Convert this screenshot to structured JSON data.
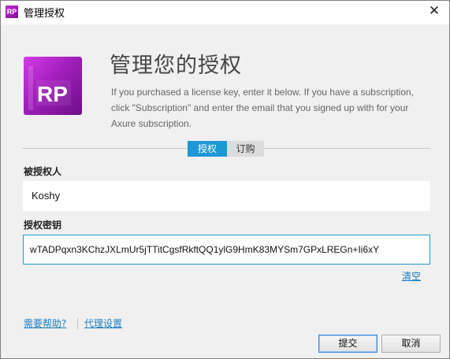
{
  "window": {
    "title": "管理授权",
    "app_icon_text": "RP",
    "close_glyph": "✕"
  },
  "header": {
    "logo_text": "RP",
    "heading": "管理您的授权",
    "description": "If you purchased a license key, enter it below. If you have a subscription, click \"Subscription\" and enter the email that you signed up with for your Axure subscription."
  },
  "tabs": [
    {
      "label": "授权",
      "active": true
    },
    {
      "label": "订购",
      "active": false
    }
  ],
  "form": {
    "licensee_label": "被授权人",
    "licensee_value": "Koshy",
    "key_label": "授权密钥",
    "key_value": "wTADPqxn3KChzJXLmUr5jTTitCgsfRkftQQ1ylG9HmK83MYSm7GPxLREGn+Ii6xY",
    "clear_link": "清空"
  },
  "footer": {
    "help_link": "需要帮助?",
    "proxy_link": "代理设置",
    "submit_button": "提交",
    "cancel_button": "取消"
  },
  "colors": {
    "accent": "#1e97d5",
    "link": "#1a7fc4",
    "logo_start": "#d33be6",
    "logo_end": "#6d0f88"
  },
  "icons": {
    "app": "axure-rp-icon",
    "close": "close-icon"
  }
}
